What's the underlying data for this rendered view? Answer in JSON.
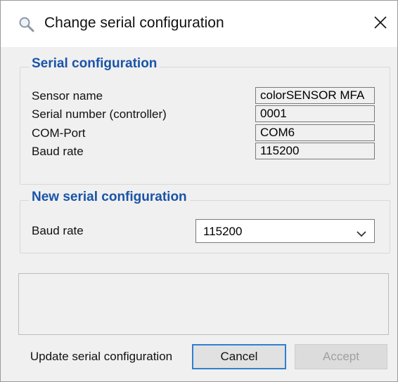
{
  "window": {
    "title": "Change serial configuration",
    "title_icon": "magnifier-icon",
    "close_icon": "close-icon"
  },
  "current": {
    "legend": "Serial configuration",
    "fields": [
      {
        "label": "Sensor name",
        "value": "colorSENSOR MFA"
      },
      {
        "label": "Serial number (controller)",
        "value": "0001"
      },
      {
        "label": "COM-Port",
        "value": "COM6"
      },
      {
        "label": "Baud rate",
        "value": "115200"
      }
    ]
  },
  "new_config": {
    "legend": "New serial configuration",
    "baud_label": "Baud rate",
    "baud_value": "115200"
  },
  "buttons": {
    "update": "Update serial configuration",
    "cancel": "Cancel",
    "accept": "Accept"
  },
  "colors": {
    "legend": "#1a54a8",
    "focus_border": "#2f7fd0",
    "disabled_text": "#a0a0a0"
  }
}
